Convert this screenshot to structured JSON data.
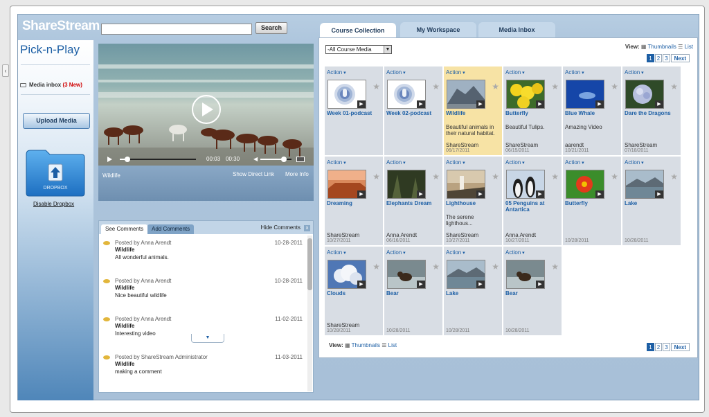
{
  "header": {
    "logo": "ShareStream",
    "search_placeholder": "",
    "search_button": "Search"
  },
  "sidebar": {
    "title": "Pick-n-Play",
    "inbox_label": "Media inbox",
    "inbox_new": "(3 New)",
    "upload": "Upload Media",
    "dropbox": "DROPBOX",
    "disable": "Disable Dropbox"
  },
  "player": {
    "title": "Wildlife",
    "time_current": "00:03",
    "time_total": "00:30",
    "direct_link": "Show Direct Link",
    "more_info": "More Info",
    "progress": 0.1,
    "volume": 0.75
  },
  "comments": {
    "tab_see": "See Comments",
    "tab_add": "Add Comments",
    "hide": "Hide Comments",
    "close": "x",
    "items": [
      {
        "by": "Posted by Anna Arendt",
        "date": "10-28-2011",
        "title": "Wildlife",
        "text": "All wonderful animals."
      },
      {
        "by": "Posted by Anna Arendt",
        "date": "10-28-2011",
        "title": "Wildlife",
        "text": "Nice beautiful wildlife"
      },
      {
        "by": "Posted by Anna Arendt",
        "date": "11-02-2011",
        "title": "Wildlife",
        "text": "Interesting video"
      },
      {
        "by": "Posted by ShareStream Administrator",
        "date": "11-03-2011",
        "title": "Wildlife",
        "text": "making a comment"
      }
    ]
  },
  "tabs": [
    "Course Collection",
    "My Workspace",
    "Media Inbox"
  ],
  "filter": {
    "value": "-All Course Media"
  },
  "view": {
    "label": "View:",
    "thumbnails": "Thumbnails",
    "list": "List"
  },
  "pagination": {
    "pages": [
      "1",
      "2",
      "3"
    ],
    "current": "1",
    "next": "Next"
  },
  "media": [
    {
      "action": "Action",
      "name": "Week 01-podcast",
      "desc": "",
      "owner": "",
      "date": "",
      "thumb": "podcast"
    },
    {
      "action": "Action",
      "name": "Week 02-podcast",
      "desc": "",
      "owner": "",
      "date": "",
      "thumb": "podcast"
    },
    {
      "action": "Action",
      "name": "Wildlife",
      "desc": "Beautiful animals in their natural habitat. ...",
      "owner": "ShareStream",
      "date": "06/17/2011",
      "thumb": "wildlife",
      "selected": true
    },
    {
      "action": "Action",
      "name": "Butterfly",
      "desc": "Beautiful Tulips.",
      "owner": "ShareStream",
      "date": "06/15/2011",
      "thumb": "tulips"
    },
    {
      "action": "Action",
      "name": "Blue Whale",
      "desc": "Amazing Video",
      "owner": "aarendt",
      "date": "10/21/2011",
      "thumb": "whale"
    },
    {
      "action": "Action",
      "name": "Dare the Dragons",
      "desc": "",
      "owner": "ShareStream",
      "date": "07/18/2011",
      "thumb": "hydrangea"
    },
    {
      "action": "Action",
      "name": "Dreaming",
      "desc": "",
      "owner": "ShareStream",
      "date": "10/27/2011",
      "thumb": "desert"
    },
    {
      "action": "Action",
      "name": "Elephants Dream",
      "desc": "",
      "owner": "Anna Arendt",
      "date": "06/16/2011",
      "thumb": "dark"
    },
    {
      "action": "Action",
      "name": "Lighthouse",
      "desc": "The serene lighthous...",
      "owner": "ShareStream",
      "date": "10/27/2011",
      "thumb": "lighthouse"
    },
    {
      "action": "Action",
      "name": "05 Penguins at Antartica",
      "desc": "",
      "owner": "Anna Arendt",
      "date": "10/27/2011",
      "thumb": "penguins"
    },
    {
      "action": "Action",
      "name": "Butterfly",
      "desc": "",
      "owner": "",
      "date": "10/28/2011",
      "thumb": "flower"
    },
    {
      "action": "Action",
      "name": "Lake",
      "desc": "",
      "owner": "",
      "date": "10/28/2011",
      "thumb": "lake"
    },
    {
      "action": "Action",
      "name": "Clouds",
      "desc": "",
      "owner": "ShareStream",
      "date": "10/28/2011",
      "thumb": "clouds"
    },
    {
      "action": "Action",
      "name": "Bear",
      "desc": "",
      "owner": "",
      "date": "10/28/2011",
      "thumb": "bear"
    },
    {
      "action": "Action",
      "name": "Lake",
      "desc": "",
      "owner": "",
      "date": "10/28/2011",
      "thumb": "lake"
    },
    {
      "action": "Action",
      "name": "Bear",
      "desc": "",
      "owner": "",
      "date": "10/28/2011",
      "thumb": "bear"
    }
  ],
  "colors": {
    "accent": "#1d5fa5",
    "new_badge": "#d00000",
    "selected_card": "#f7e3a5",
    "card": "#d8dde4"
  }
}
